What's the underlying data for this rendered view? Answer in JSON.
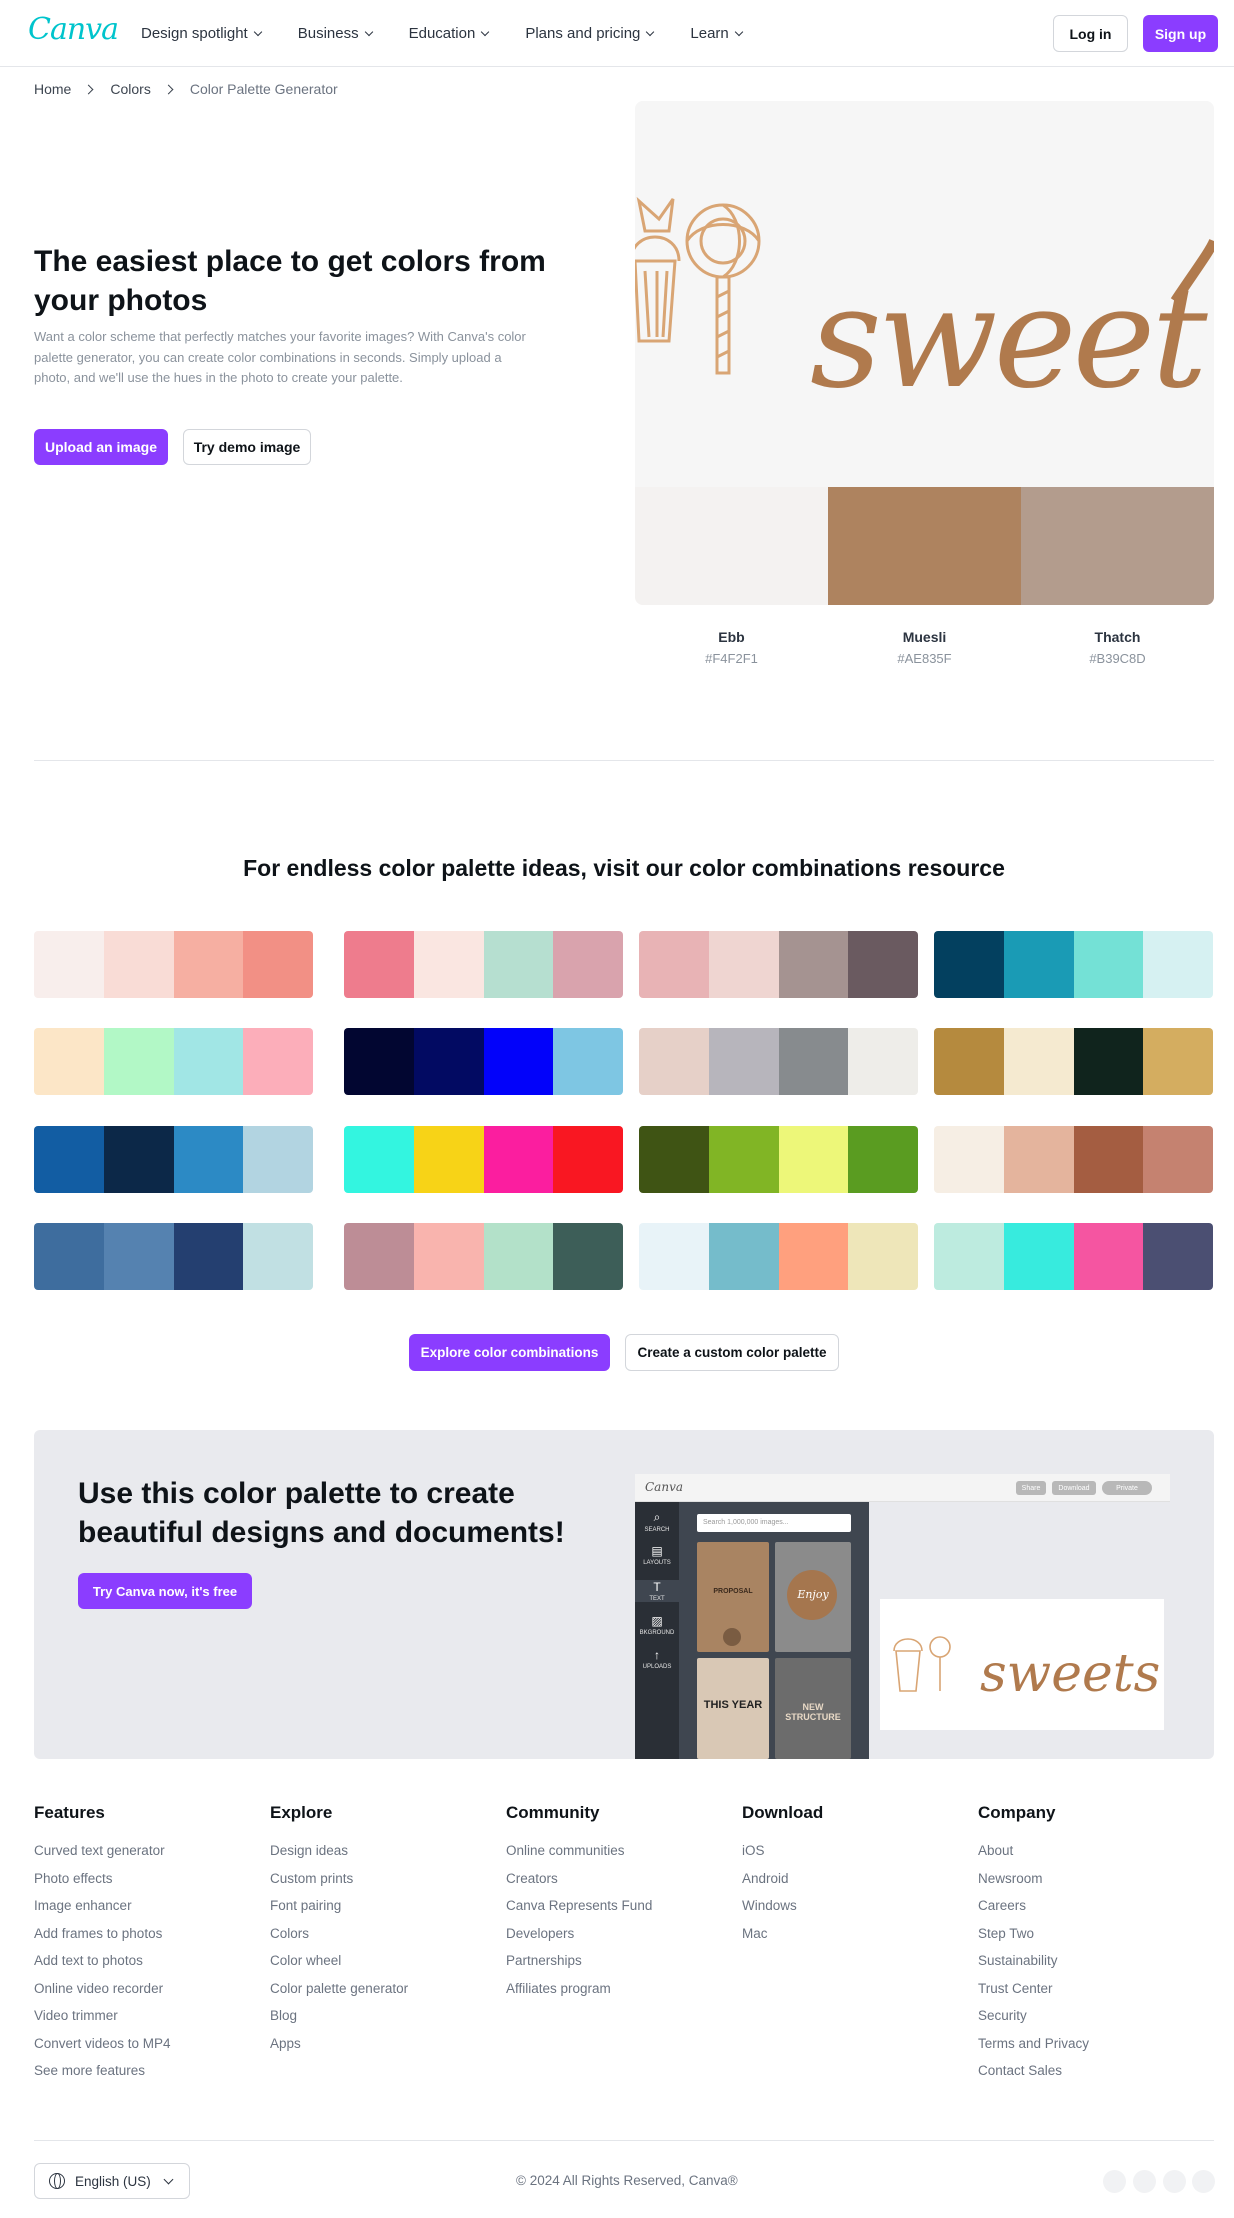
{
  "nav": {
    "logo": "Canva",
    "menu": [
      "Design spotlight",
      "Business",
      "Education",
      "Plans and pricing",
      "Learn"
    ],
    "login": "Log in",
    "signup": "Sign up"
  },
  "breadcrumb": [
    "Home",
    "Colors",
    "Color Palette Generator"
  ],
  "hero": {
    "title": "The easiest place to get colors from your photos",
    "description": "Want a color scheme that perfectly matches your favorite images? With Canva's color palette generator, you can create color combinations in seconds. Simply upload a photo, and we'll use the hues in the photo to create your palette.",
    "upload_button": "Upload an image",
    "demo_button": "Try demo image",
    "image_text": "sweet",
    "swatches": [
      {
        "name": "Ebb",
        "hex": "#F4F2F1"
      },
      {
        "name": "Muesli",
        "hex": "#AE835F"
      },
      {
        "name": "Thatch",
        "hex": "#B39C8D"
      }
    ]
  },
  "combinations": {
    "title": "For endless color palette ideas, visit our color combinations resource",
    "palettes": [
      [
        "#F8EEEC",
        "#F9DCD6",
        "#F6AFA2",
        "#F29085"
      ],
      [
        "#EE7C8D",
        "#FAE6E1",
        "#B6DFD0",
        "#D9A3AD"
      ],
      [
        "#E8B3B5",
        "#EFD5D1",
        "#A59391",
        "#6A5A60"
      ],
      [
        "#03405F",
        "#1A9BB5",
        "#74E1D6",
        "#D6F1F2"
      ],
      [
        "#FCE6C7",
        "#B2F8C6",
        "#A1E6E5",
        "#FCAEBA"
      ],
      [
        "#020631",
        "#020A62",
        "#0202FA",
        "#7EC6E3"
      ],
      [
        "#E6D0C8",
        "#B7B5BC",
        "#878B8E",
        "#EEEDE9"
      ],
      [
        "#B58A3E",
        "#F5EAD0",
        "#10241D",
        "#D4AD60"
      ],
      [
        "#125DA3",
        "#0C2848",
        "#2C8AC5",
        "#B2D4E1"
      ],
      [
        "#33F5E0",
        "#F7D317",
        "#FB1E9F",
        "#F91722"
      ],
      [
        "#3F5414",
        "#81B525",
        "#EDF779",
        "#5A9C21"
      ],
      [
        "#F6EEE4",
        "#E4B49D",
        "#A45D41",
        "#C58270"
      ],
      [
        "#3E6D9E",
        "#5582B0",
        "#243F70",
        "#C1E0E3"
      ],
      [
        "#BD8D96",
        "#F9B4AE",
        "#B3E1C9",
        "#3D5E58"
      ],
      [
        "#E8F3F8",
        "#75BCCB",
        "#FFA07E",
        "#EEE6B9"
      ],
      [
        "#BDEBDF",
        "#37EBDE",
        "#F555A1",
        "#4B4F72"
      ]
    ],
    "explore_button": "Explore color combinations",
    "custom_button": "Create a custom color palette"
  },
  "cta": {
    "title": "Use this color palette to create beautiful designs and documents!",
    "button": "Try Canva now, it's free",
    "editor": {
      "logo": "Canva",
      "share": "Share",
      "download": "Download",
      "private": "Private",
      "search_placeholder": "Search 1,000,000 images...",
      "side_items": [
        "SEARCH",
        "LAYOUTS",
        "TEXT",
        "BKGROUND",
        "UPLOADS"
      ],
      "tiles": [
        "PROPOSAL",
        "Enjoy",
        "THIS YEAR",
        "NEW STRUCTURE"
      ],
      "canvas_text": "sweets"
    }
  },
  "footer": {
    "columns": [
      {
        "title": "Features",
        "links": [
          "Curved text generator",
          "Photo effects",
          "Image enhancer",
          "Add frames to photos",
          "Add text to photos",
          "Online video recorder",
          "Video trimmer",
          "Convert videos to MP4",
          "See more features"
        ]
      },
      {
        "title": "Explore",
        "links": [
          "Design ideas",
          "Custom prints",
          "Font pairing",
          "Colors",
          "Color wheel",
          "Color palette generator",
          "Blog",
          "Apps"
        ]
      },
      {
        "title": "Community",
        "links": [
          "Online communities",
          "Creators",
          "Canva Represents Fund",
          "Developers",
          "Partnerships",
          "Affiliates program"
        ]
      },
      {
        "title": "Download",
        "links": [
          "iOS",
          "Android",
          "Windows",
          "Mac"
        ]
      },
      {
        "title": "Company",
        "links": [
          "About",
          "Newsroom",
          "Careers",
          "Step Two",
          "Sustainability",
          "Trust Center",
          "Security",
          "Terms and Privacy",
          "Contact Sales"
        ]
      }
    ],
    "language": "English (US)",
    "copyright": "© 2024 All Rights Reserved, Canva®"
  }
}
